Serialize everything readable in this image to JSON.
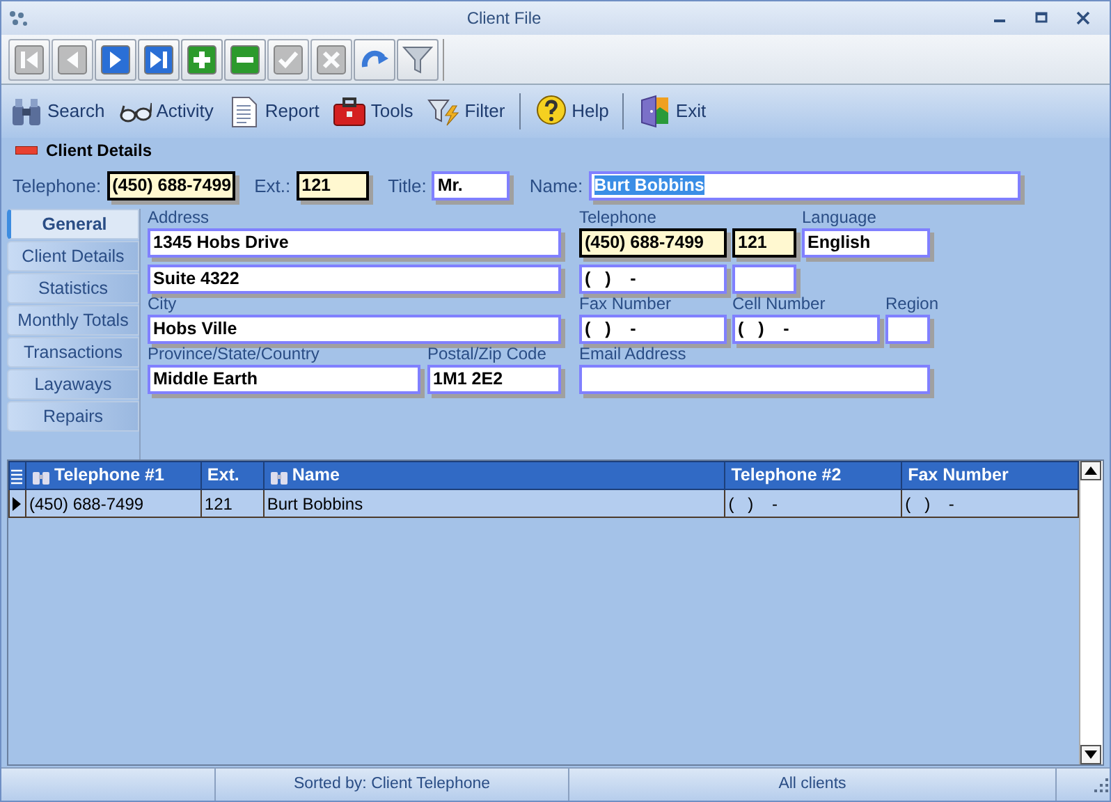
{
  "window": {
    "title": "Client File"
  },
  "nav_toolbar": [
    {
      "kind": "first",
      "disabled": true
    },
    {
      "kind": "previous",
      "disabled": true
    },
    {
      "kind": "next",
      "disabled": false
    },
    {
      "kind": "last",
      "disabled": false
    },
    {
      "kind": "add",
      "disabled": false
    },
    {
      "kind": "delete",
      "disabled": false
    },
    {
      "kind": "confirm",
      "disabled": true
    },
    {
      "kind": "cancel",
      "disabled": true
    },
    {
      "kind": "refresh",
      "disabled": false
    },
    {
      "kind": "filter",
      "disabled": false
    }
  ],
  "command_groups": [
    [
      {
        "kind": "search",
        "label": "Search"
      },
      {
        "kind": "activity",
        "label": "Activity"
      },
      {
        "kind": "report",
        "label": "Report"
      },
      {
        "kind": "tools",
        "label": "Tools"
      },
      {
        "kind": "filter",
        "label": "Filter"
      }
    ],
    [
      {
        "kind": "help",
        "label": "Help"
      }
    ],
    [
      {
        "kind": "exit",
        "label": "Exit"
      }
    ]
  ],
  "section_title": "Client Details",
  "header_fields": [
    {
      "label": "Telephone:",
      "value": "(450) 688-7499",
      "highlighted": true,
      "text_selected": false
    },
    {
      "label": "Ext.:",
      "value": "121",
      "highlighted": true,
      "text_selected": false
    },
    {
      "label": "Title:",
      "value": "Mr.",
      "highlighted": false,
      "text_selected": false
    },
    {
      "label": "Name:",
      "value": "Burt Bobbins",
      "highlighted": false,
      "text_selected": true
    }
  ],
  "tabs": [
    {
      "label": "General",
      "selected": true
    },
    {
      "label": "Client Details",
      "selected": false
    },
    {
      "label": "Statistics",
      "selected": false
    },
    {
      "label": "Monthly Totals",
      "selected": false
    },
    {
      "label": "Transactions",
      "selected": false
    },
    {
      "label": "Layaways",
      "selected": false
    },
    {
      "label": "Repairs",
      "selected": false
    }
  ],
  "general_form": [
    {
      "kind": "label",
      "text": "Address"
    },
    {
      "kind": "label",
      "text": "Telephone"
    },
    {
      "kind": "label",
      "text": "Language"
    },
    {
      "kind": "field",
      "value": "1345 Hobs Drive",
      "highlighted": false
    },
    {
      "kind": "field",
      "value": "(450) 688-7499",
      "highlighted": true
    },
    {
      "kind": "field",
      "value": "121",
      "highlighted": true
    },
    {
      "kind": "field",
      "value": "English",
      "highlighted": false
    },
    {
      "kind": "field",
      "value": "Suite 4322",
      "highlighted": false
    },
    {
      "kind": "field",
      "value": "(   )    -",
      "highlighted": false
    },
    {
      "kind": "field",
      "highlighted": false
    },
    {
      "kind": "label",
      "text": "City"
    },
    {
      "kind": "label",
      "text": "Fax Number"
    },
    {
      "kind": "label",
      "text": "Cell Number"
    },
    {
      "kind": "label",
      "text": "Region"
    },
    {
      "kind": "field",
      "value": "Hobs Ville",
      "highlighted": false
    },
    {
      "kind": "field",
      "value": "(   )    -",
      "highlighted": false
    },
    {
      "kind": "field",
      "value": "(   )    -",
      "highlighted": false
    },
    {
      "kind": "field",
      "highlighted": false
    },
    {
      "kind": "label",
      "text": "Province/State/Country"
    },
    {
      "kind": "label",
      "text": "Postal/Zip Code"
    },
    {
      "kind": "label",
      "text": "Email Address"
    },
    {
      "kind": "field",
      "value": "Middle Earth",
      "highlighted": false
    },
    {
      "kind": "field",
      "value": "1M1 2E2",
      "highlighted": false
    },
    {
      "kind": "field",
      "highlighted": false
    }
  ],
  "table": {
    "columns": [
      {
        "title": "Telephone #1",
        "searchable": true
      },
      {
        "title": "Ext.",
        "searchable": false
      },
      {
        "title": "Name",
        "searchable": true
      },
      {
        "title": "Telephone #2",
        "searchable": false
      },
      {
        "title": "Fax Number",
        "searchable": false
      }
    ],
    "rows": [
      {
        "selected": true,
        "cells": [
          "(450) 688-7499",
          "121",
          "Burt Bobbins",
          "(   )    -",
          "(   )    -"
        ]
      }
    ]
  },
  "status_bar": {
    "panes": [
      "Sorted by: Client Telephone",
      "All clients"
    ]
  }
}
